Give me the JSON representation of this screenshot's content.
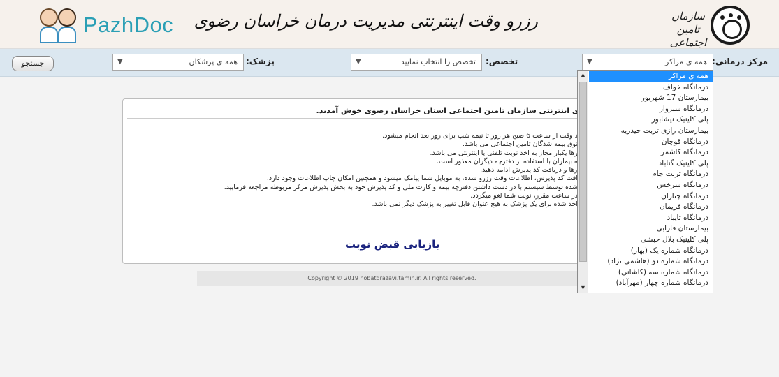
{
  "header": {
    "logo_text_line1": "سازمان",
    "logo_text_line2": "تامین اجتماعی",
    "title": "رزرو وقت اینترنتی مدیریت درمان خراسان رضوی",
    "brand": "PazhDoc"
  },
  "filters": {
    "center_label": "مرکز درمانی:",
    "center_value": "همه ی مراکز",
    "specialty_label": "تخصص:",
    "specialty_value": "تخصص را انتخاب نمایید",
    "doctor_label": "پزشک:",
    "doctor_value": "همه ی پزشکان",
    "search_button": "جستجو"
  },
  "content": {
    "welcome": "ی اینترنتی سازمان تامین اجتماعی استان خراسان رضوی خوش آمدید.",
    "rules": [
      "د وقت از ساعت 6 صبح هر روز تا نیمه شب برای روز بعد انجام میشود.",
      "توق بیمه شدگان تامین اجتماعی می باشد.",
      "رها یکبار مجاز به اخذ نوبت تلفنی یا اینترنتی می باشد.",
      "ه بیماران با استفاده از دفترچه دیگران معذور است.",
      "رها و دریافت کد پذیرش ادامه دهید.",
      "افت کد پذیرش، اطلاعات وقت رزرو شده، به موبایل شما پیامک میشود و همچنین امکان چاپ اطلاعات وجود دارد.",
      "شده توسط سیستم با در دست داشتن دفترچه بیمه و کارت ملی و کد پذیرش خود به بخش پذیرش مرکز مربوطه مراجعه فرمایید.",
      "در ساعت مقرر، نوبت شما لغو میگردد.",
      "اخذ شده برای یک پزشک به هیچ عنوان قابل تغییر به پزشک دیگر نمی باشد."
    ],
    "review_link": "بازیابی قبض نوبت"
  },
  "footer": "Copyright © 2019 nobatdrazavi.tamin.ir. All rights reserved.",
  "dropdown": {
    "items": [
      "همه ی مراکز",
      "درمانگاه خواف",
      "بیمارستان 17 شهریور",
      "درمانگاه سبزوار",
      "پلی کلینیک نیشابور",
      "بیمارستان رازی تربت حیدریه",
      "درمانگاه قوچان",
      "درمانگاه کاشمر",
      "پلی کلینیک گناباد",
      "درمانگاه تربت جام",
      "درمانگاه سرخس",
      "درمانگاه چناران",
      "درمانگاه فریمان",
      "درمانگاه تایباد",
      "بیمارستان فارابی",
      "پلی کلینیک بلال حبشی",
      "درمانگاه شماره یک (بهار)",
      "درمانگاه شماره دو (هاشمی نژاد)",
      "درمانگاه شماره سه (کاشانی)",
      "درمانگاه شماره چهار (مهرآباد)"
    ],
    "selected_index": 0
  },
  "colors": {
    "header_bg": "#f6f1ec",
    "filter_bg": "#dbe7f0",
    "brand": "#2a9fb5",
    "selection": "#1e90ff",
    "link": "#1a237e"
  }
}
